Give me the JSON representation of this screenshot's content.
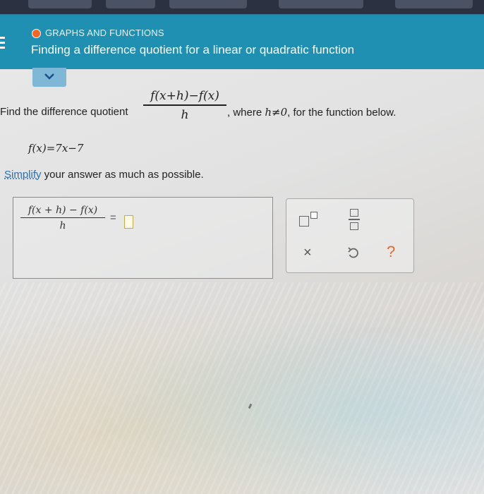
{
  "header": {
    "topic": "GRAPHS AND FUNCTIONS",
    "title": "Finding a difference quotient for a linear or quadratic function",
    "accent_color": "#1f8fb2",
    "topic_dot_color": "#f26522"
  },
  "question": {
    "prefix": "Find the difference quotient",
    "quotient_numerator": "f(x+h)−f(x)",
    "quotient_denominator": "h",
    "where_text": ", where",
    "condition": "h≠0",
    "suffix": ", for the function below.",
    "function": "f(x)=7x−7",
    "instruction_link": "Simplify",
    "instruction_rest": " your answer as much as possible."
  },
  "answer": {
    "numerator": "f(x + h) − f(x)",
    "denominator": "h",
    "equals": "=",
    "value": ""
  },
  "toolbox": {
    "icons": [
      "superscript-icon",
      "fraction-icon",
      "clear-icon",
      "undo-icon",
      "help-icon"
    ],
    "clear_label": "×",
    "help_label": "?"
  }
}
